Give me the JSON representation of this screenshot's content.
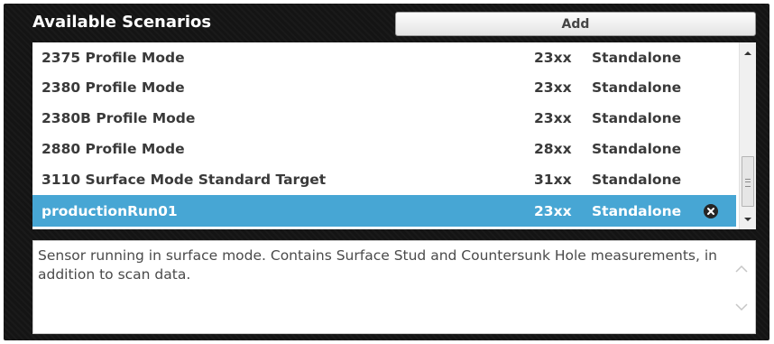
{
  "panel": {
    "title": "Available Scenarios",
    "add_label": "Add"
  },
  "scenarios": [
    {
      "name": "2375 Profile Mode",
      "model": "23xx",
      "mode": "Standalone",
      "selected": false
    },
    {
      "name": "2380 Profile Mode",
      "model": "23xx",
      "mode": "Standalone",
      "selected": false
    },
    {
      "name": "2380B Profile Mode",
      "model": "23xx",
      "mode": "Standalone",
      "selected": false
    },
    {
      "name": "2880 Profile Mode",
      "model": "28xx",
      "mode": "Standalone",
      "selected": false
    },
    {
      "name": "3110 Surface Mode Standard Target",
      "model": "31xx",
      "mode": "Standalone",
      "selected": false
    },
    {
      "name": "productionRun01",
      "model": "23xx",
      "mode": "Standalone",
      "selected": true
    }
  ],
  "description": "Sensor running in surface mode. Contains Surface Stud and Countersunk Hole measurements, in addition to scan data.",
  "icons": {
    "remove": "remove-circle-icon",
    "scroll_up": "arrow-up-icon",
    "scroll_down": "arrow-down-icon"
  },
  "colors": {
    "selection": "#47a6d4",
    "panel_background": "#141414",
    "text": "#3a3a3a"
  }
}
